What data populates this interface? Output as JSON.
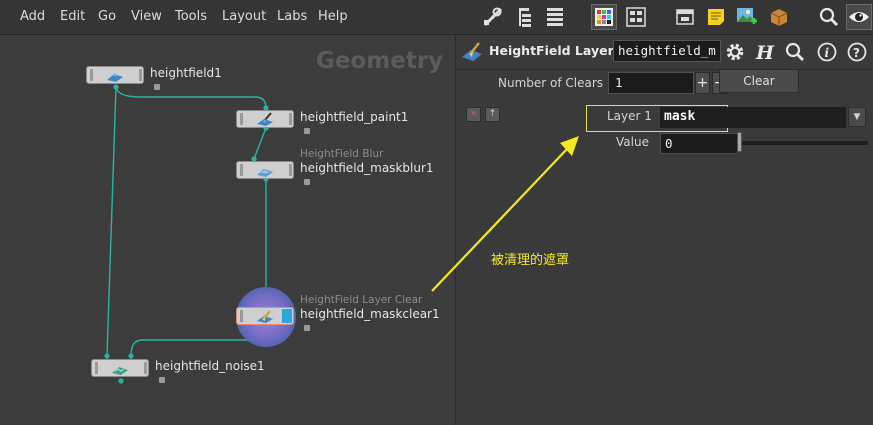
{
  "menu": [
    "Add",
    "Edit",
    "Go",
    "View",
    "Tools",
    "Layout",
    "Labs",
    "Help"
  ],
  "toolbar_icons": [
    "tools-icon",
    "tree-view-icon",
    "list-view-icon",
    "color-palette-icon",
    "shape-palette-icon",
    "network-box-icon",
    "sticky-note-icon",
    "background-image-icon",
    "subnet-box-icon",
    "search-icon",
    "visibility-eye-icon"
  ],
  "network": {
    "context_label": "Geometry",
    "nodes": [
      {
        "id": "heightfield1",
        "name": "heightfield1",
        "type": ""
      },
      {
        "id": "heightfield_paint1",
        "name": "heightfield_paint1",
        "type": ""
      },
      {
        "id": "heightfield_maskblur1",
        "name": "heightfield_maskblur1",
        "type": "HeightField Blur"
      },
      {
        "id": "heightfield_maskclear1",
        "name": "heightfield_maskclear1",
        "type": "HeightField Layer Clear"
      },
      {
        "id": "heightfield_noise1",
        "name": "heightfield_noise1",
        "type": ""
      }
    ],
    "wire_color": "#29b3a3"
  },
  "params": {
    "node_type_label": "HeightField Layer...",
    "node_name": "heightfield_m",
    "header_icons": [
      "gear-icon",
      "houdini-help-icon",
      "search-icon",
      "info-icon",
      "help-icon"
    ],
    "number_of_clears_label": "Number of Clears",
    "number_of_clears_value": "1",
    "plus_label": "+",
    "minus_label": "−",
    "clear_button_label": "Clear",
    "layer_label": "Layer 1",
    "layer_value": "mask",
    "value_label": "Value",
    "value_value": "0",
    "value_fraction": 0.0
  },
  "annotation": {
    "text": "被清理的遮罩",
    "color": "#f5ea1f"
  },
  "colors": {
    "accent_highlight": "#e8e04a",
    "selected_node_ring": "#7a6ec8",
    "selected_node_flag": "#29a8e0"
  }
}
